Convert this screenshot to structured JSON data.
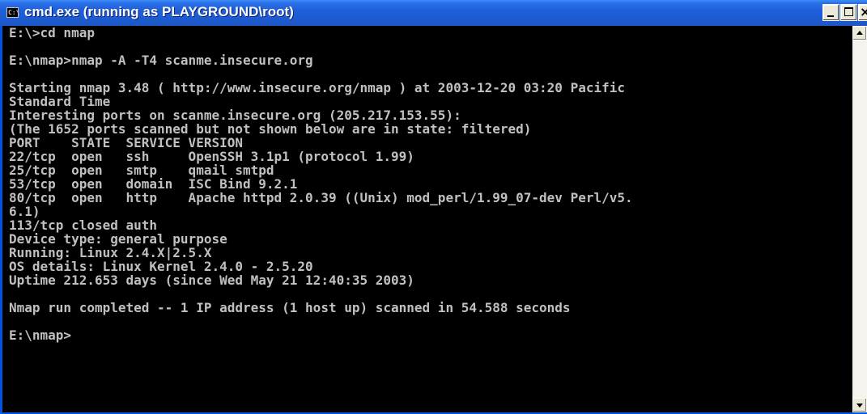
{
  "window": {
    "title": "cmd.exe (running as PLAYGROUND\\root)",
    "icon_text": "C:\\"
  },
  "console": {
    "lines": [
      "E:\\>cd nmap",
      "",
      "E:\\nmap>nmap -A -T4 scanme.insecure.org",
      "",
      "Starting nmap 3.48 ( http://www.insecure.org/nmap ) at 2003-12-20 03:20 Pacific",
      "Standard Time",
      "Interesting ports on scanme.insecure.org (205.217.153.55):",
      "(The 1652 ports scanned but not shown below are in state: filtered)",
      "PORT    STATE  SERVICE VERSION",
      "22/tcp  open   ssh     OpenSSH 3.1p1 (protocol 1.99)",
      "25/tcp  open   smtp    qmail smtpd",
      "53/tcp  open   domain  ISC Bind 9.2.1",
      "80/tcp  open   http    Apache httpd 2.0.39 ((Unix) mod_perl/1.99_07-dev Perl/v5.",
      "6.1)",
      "113/tcp closed auth",
      "Device type: general purpose",
      "Running: Linux 2.4.X|2.5.X",
      "OS details: Linux Kernel 2.4.0 - 2.5.20",
      "Uptime 212.653 days (since Wed May 21 12:40:35 2003)",
      "",
      "Nmap run completed -- 1 IP address (1 host up) scanned in 54.588 seconds",
      "",
      "E:\\nmap>"
    ]
  },
  "controls": {
    "minimize_icon": "minimize-icon",
    "maximize_icon": "maximize-icon",
    "close_icon": "close-icon",
    "close_glyph": "×"
  }
}
